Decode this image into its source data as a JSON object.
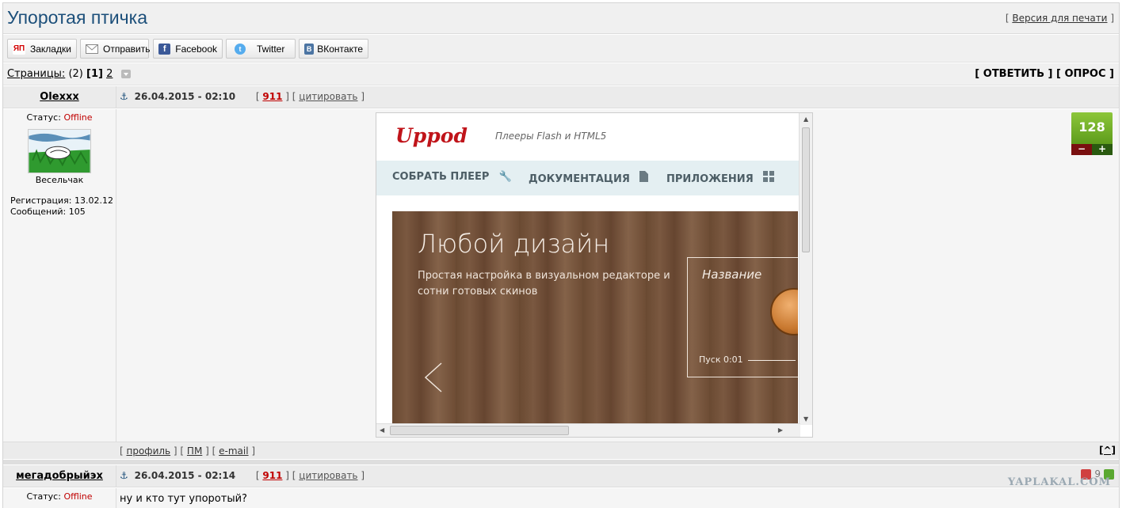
{
  "header": {
    "title": "Упоротая птичка",
    "print_prefix": "[",
    "print_link": "Версия для печати",
    "print_suffix": "]"
  },
  "share_buttons": [
    {
      "label": "Закладки",
      "icon": "yandex-bookmarks-icon",
      "color": "#d10000"
    },
    {
      "label": "Отправить",
      "icon": "envelope-icon",
      "color": "#888888"
    },
    {
      "label": "Facebook",
      "icon": "facebook-icon",
      "color": "#3b5998"
    },
    {
      "label": "Twitter",
      "icon": "twitter-icon",
      "color": "#55acee"
    },
    {
      "label": "ВКонтакте",
      "icon": "vk-icon",
      "color": "#4c75a3"
    }
  ],
  "pagination": {
    "label": "Страницы:",
    "count": "(2)",
    "current": "[1]",
    "next": "2"
  },
  "actions": {
    "reply": "[ ОТВЕТИТЬ ]",
    "poll": "[ ОПРОС ]"
  },
  "post1": {
    "author": "Olexxx",
    "status_label": "Статус:",
    "status_value": "Offline",
    "rank": "Весельчак",
    "registration": "Регистрация: 13.02.12",
    "messages": "Сообщений: 105",
    "anchor": "⚓",
    "date": "26.04.2015 - 02:10",
    "post_id": "911",
    "quote": "цитировать",
    "rating": "128",
    "vote_minus": "−",
    "vote_plus": "+",
    "embed": {
      "logo": "Uppod",
      "tagline": "Плееры Flash и HTML5",
      "nav": [
        "СОБРАТЬ ПЛЕЕР",
        "ДОКУМЕНТАЦИЯ",
        "ПРИЛОЖЕНИЯ"
      ],
      "banner_title": "Любой дизайн",
      "banner_sub": "Простая настройка в визуальном редакторе и сотни готовых скинов",
      "box_name": "Название",
      "play_label": "Пуск 0:01"
    },
    "footer_links": [
      "профиль",
      "ПМ",
      "e-mail"
    ],
    "top_link": "[^]"
  },
  "post2": {
    "author": "мегадобрыйэх",
    "status_label": "Статус:",
    "status_value": "Offline",
    "anchor": "⚓",
    "date": "26.04.2015 - 02:14",
    "post_id": "911",
    "quote": "цитировать",
    "rating": "9",
    "message": "ну и кто тут упоротый?"
  },
  "watermark": "YAPLAKAL.COM"
}
